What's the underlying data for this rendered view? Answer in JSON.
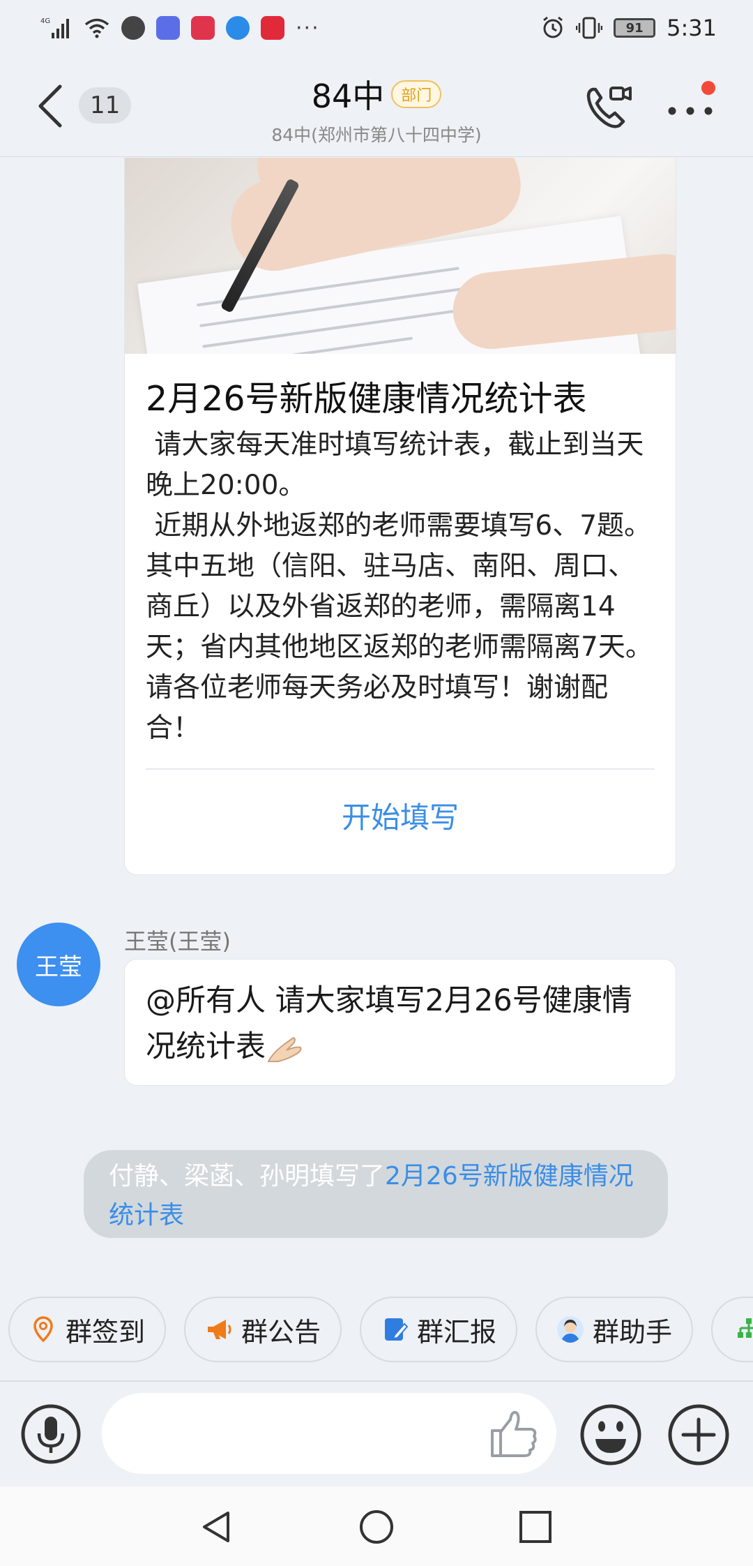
{
  "status_bar": {
    "network": "4G",
    "battery": "91",
    "time": "5:31",
    "overflow": "···"
  },
  "header": {
    "unread_count": "11",
    "title": "84中",
    "badge": "部门",
    "subtitle": "84中(郑州市第八十四中学)"
  },
  "card": {
    "title": "2月26号新版健康情况统计表",
    "body": " 请大家每天准时填写统计表，截止到当天晚上20:00。\n 近期从外地返郑的老师需要填写6、7题。其中五地（信阳、驻马店、南阳、周口、商丘）以及外省返郑的老师，需隔离14天；省内其他地区返郑的老师需隔离7天。请各位老师每天务必及时填写！谢谢配合！",
    "action": "开始填写"
  },
  "message": {
    "avatar_text": "王莹",
    "sender": "王莹(王莹)",
    "text": "@所有人   请大家填写2月26号健康情况统计表"
  },
  "notice": {
    "prefix": "付静、梁菡、孙明填写了",
    "link": "2月26号新版健康情况统计表"
  },
  "quick_actions": [
    {
      "label": "群签到",
      "icon": "location-check-icon",
      "color": "#f07b1a"
    },
    {
      "label": "群公告",
      "icon": "megaphone-icon",
      "color": "#f07b1a"
    },
    {
      "label": "群汇报",
      "icon": "report-icon",
      "color": "#2f7de1"
    },
    {
      "label": "群助手",
      "icon": "assistant-avatar-icon",
      "color": "#2f7de1"
    }
  ],
  "colors": {
    "accent": "#3a8ee6",
    "avatar": "#3d8ff0",
    "badge": "#e0a21b"
  }
}
